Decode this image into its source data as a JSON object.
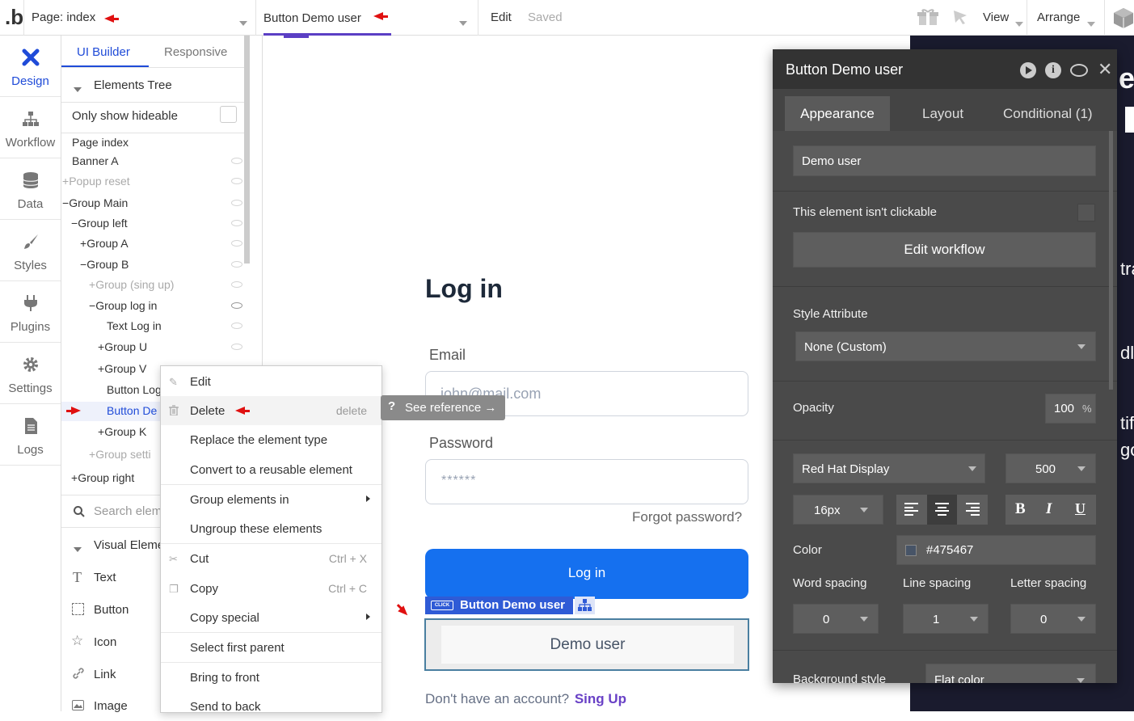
{
  "topbar": {
    "logo": ".b",
    "page_selector": "Page: index",
    "element_selector": "Button Demo user",
    "edit": "Edit",
    "saved": "Saved",
    "view": "View",
    "arrange": "Arrange"
  },
  "leftnav": {
    "items": [
      {
        "label": "Design",
        "icon": "design-icon"
      },
      {
        "label": "Workflow",
        "icon": "workflow-icon"
      },
      {
        "label": "Data",
        "icon": "database-icon"
      },
      {
        "label": "Styles",
        "icon": "brush-icon"
      },
      {
        "label": "Plugins",
        "icon": "plug-icon"
      },
      {
        "label": "Settings",
        "icon": "gear-icon"
      },
      {
        "label": "Logs",
        "icon": "document-icon"
      }
    ]
  },
  "panel": {
    "tabs": [
      "UI Builder",
      "Responsive"
    ],
    "tree_header": "Elements Tree",
    "only_hideable": "Only show hideable",
    "tree": [
      "Page index",
      "Banner A",
      "Popup reset",
      "Group Main",
      "Group left",
      "Group A",
      "Group B",
      "Group (sing up)",
      "Group log in",
      "Text Log in",
      "Group U",
      "Group V",
      "Button Log",
      "Button De",
      "Group K",
      "Group setti",
      "Group right"
    ],
    "search_placeholder": "Search elem",
    "visual_header": "Visual Eleme",
    "visual_items": [
      "Text",
      "Button",
      "Icon",
      "Link",
      "Image"
    ]
  },
  "context_menu": {
    "items": [
      {
        "label": "Edit",
        "shortcut": ""
      },
      {
        "label": "Delete",
        "shortcut": "delete"
      },
      {
        "label": "Replace the element type",
        "shortcut": ""
      },
      {
        "label": "Convert to a reusable element",
        "shortcut": ""
      },
      {
        "label": "Group elements in",
        "shortcut": ""
      },
      {
        "label": "Ungroup these elements",
        "shortcut": ""
      },
      {
        "label": "Cut",
        "shortcut": "Ctrl + X"
      },
      {
        "label": "Copy",
        "shortcut": "Ctrl + C"
      },
      {
        "label": "Copy special",
        "shortcut": ""
      },
      {
        "label": "Select first parent",
        "shortcut": ""
      },
      {
        "label": "Bring to front",
        "shortcut": ""
      },
      {
        "label": "Send to back",
        "shortcut": ""
      }
    ],
    "see_reference": "See reference →"
  },
  "canvas": {
    "heading": "Log in",
    "email_label": "Email",
    "email_placeholder": "john@mail.com",
    "password_label": "Password",
    "password_placeholder": "******",
    "forgot": "Forgot password?",
    "login_button": "Log in",
    "click_badge": "CLICK",
    "selected_label": "Button Demo user",
    "demo_button": "Demo user",
    "no_account": "Don't have an account?",
    "sign_up": "Sing Up"
  },
  "props": {
    "title": "Button Demo user",
    "tabs": [
      "Appearance",
      "Layout",
      "Conditional (1)"
    ],
    "text_value": "Demo user",
    "not_clickable": "This element isn't clickable",
    "edit_workflow": "Edit workflow",
    "style_attr_label": "Style Attribute",
    "style_attr_value": "None (Custom)",
    "opacity_label": "Opacity",
    "opacity_value": "100",
    "opacity_unit": "%",
    "font": "Red Hat Display",
    "weight": "500",
    "size": "16px",
    "color_label": "Color",
    "color_value": "#475467",
    "word_spacing": "Word spacing",
    "line_spacing": "Line spacing",
    "letter_spacing": "Letter spacing",
    "word_val": "0",
    "line_val": "1",
    "letter_val": "0",
    "bg_style_label": "Background style",
    "bg_style_value": "Flat color"
  },
  "colors": {
    "accent": "#1f4bd8",
    "primary_button": "#1570ef",
    "dark_bg": "#1a1b2e",
    "panel": "#4a4a4a",
    "signup": "#6941c6"
  }
}
